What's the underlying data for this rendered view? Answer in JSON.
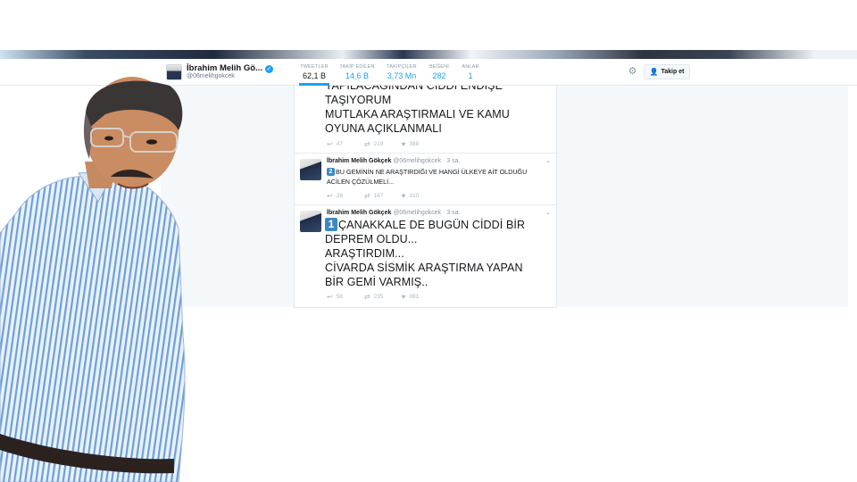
{
  "profile": {
    "name": "İbrahim Melih Gö...",
    "handle": "@06melihgokcek",
    "verified_icon": "verified-badge-icon"
  },
  "stats": [
    {
      "label": "TWEETLER",
      "value": "62,1 B"
    },
    {
      "label": "TAKİP EDİLEN",
      "value": "14,6 B"
    },
    {
      "label": "TAKİPÇİLER",
      "value": "3,73 Mn"
    },
    {
      "label": "BEĞENİ",
      "value": "282"
    },
    {
      "label": "ANLAR",
      "value": "1"
    }
  ],
  "actions": {
    "follow_label": "Takip et"
  },
  "tweets": [
    {
      "lines": [
        "YAPILACAĞINDAN CİDDİ ENDİŞE",
        "TAŞIYORUM",
        "MUTLAKA ARAŞTIRMALI VE KAMU",
        "OYUNA AÇIKLANMALI"
      ],
      "replies": "47",
      "retweets": "219",
      "likes": "388"
    },
    {
      "author": "İbrahim Melih Gökçek",
      "handle": "@06melihgokcek · 3 sa.",
      "badge": "2",
      "lines": [
        "BU GEMİNİN NE ARAŞTIRDIĞI VE HANGİ ÜLKEYE AİT OLDUĞU",
        "ACİLEN ÇÖZÜLMELİ..."
      ],
      "replies": "26",
      "retweets": "187",
      "likes": "310"
    },
    {
      "author": "İbrahim Melih Gökçek",
      "handle": "@06melihgokcek · 3 sa.",
      "badge": "1",
      "lines": [
        "ÇANAKKALE DE BUGÜN CİDDİ BİR",
        "DEPREM OLDU...",
        "ARAŞTIRDIM...",
        "CİVARDA SİSMİK ARAŞTIRMA YAPAN",
        "BİR GEMİ VARMIŞ.."
      ],
      "replies": "58",
      "retweets": "235",
      "likes": "381"
    }
  ],
  "colors": {
    "accent": "#1da1f2",
    "badge": "#3b88c3",
    "text": "#14171a",
    "muted": "#8899a6"
  }
}
